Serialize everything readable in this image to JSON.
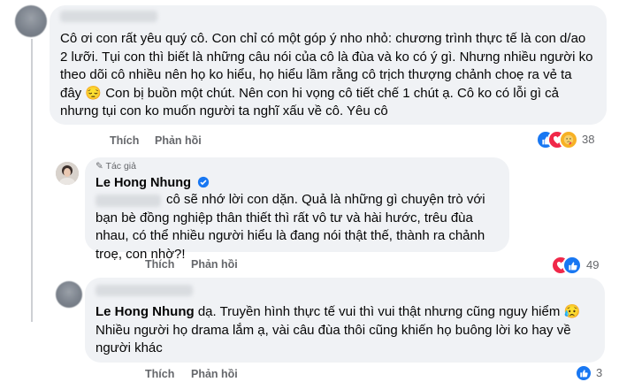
{
  "comment1": {
    "text": "Cô ơi con rất yêu quý cô. Con chỉ có một góp ý nho nhỏ: chương trình thực tế là con d/ao 2 lưỡi. Tụi con thì biết là những câu nói của cô là đùa và ko có ý gì. Nhưng nhiều người ko theo dõi cô nhiều nên họ ko hiểu, họ hiểu lầm rằng cô trịch thượng chảnh choẹ ra vẻ ta đây 😔 Con bị buồn một chút. Nên con hi vọng cô tiết chế 1 chút ạ. Cô ko có lỗi gì cả nhưng tụi con ko muốn người ta nghĩ xấu về cô. Yêu cô",
    "like_label": "Thích",
    "reply_label": "Phản hồi",
    "reaction_count": "38",
    "reactions": [
      "like",
      "love",
      "care"
    ]
  },
  "reply1": {
    "author_tag": "Tác giả",
    "author_name": "Le Hong Nhung",
    "verified": true,
    "text": "cô sẽ nhớ lời con dặn. Quả là những gì chuyện trò với bạn bè đồng nghiệp thân thiết thì rất vô tư và hài hước, trêu đùa nhau, có thể nhiều người hiểu là đang nói thật thế, thành ra chảnh troẹ, con nhờ?!",
    "like_label": "Thích",
    "reply_label": "Phản hồi",
    "reaction_count": "49",
    "reactions": [
      "love",
      "like"
    ]
  },
  "reply2": {
    "mention": "Le Hong Nhung",
    "text": "dạ. Truyền hình thực tế vui thì vui thật nhưng cũng nguy hiểm 😥 Nhiều người họ drama lắm ạ, vài câu đùa thôi cũng khiến họ buông lời ko hay về người khác",
    "like_label": "Thích",
    "reply_label": "Phản hồi",
    "reaction_count": "3",
    "reactions": [
      "like"
    ]
  },
  "colors": {
    "bubble": "#f0f2f5",
    "text": "#050505",
    "secondary": "#65676b",
    "like": "#1877f2",
    "love": "#f02849",
    "haha": "#f7b125"
  }
}
